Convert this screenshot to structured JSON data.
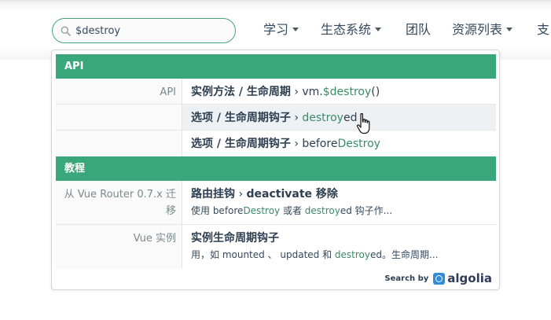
{
  "search": {
    "value": "$destroy",
    "placeholder": ""
  },
  "nav": [
    {
      "label": "学习",
      "has_caret": true
    },
    {
      "label": "生态系统",
      "has_caret": true
    },
    {
      "label": "团队",
      "has_caret": false
    },
    {
      "label": "资源列表",
      "has_caret": true
    },
    {
      "label": "支",
      "has_caret": false
    }
  ],
  "results": {
    "categories": [
      {
        "name": "API",
        "rows": [
          {
            "sub": "API",
            "title": "实例方法 / 生命周期",
            "sep": " › ",
            "pre": "vm.",
            "hl": "$destroy",
            "post": "()"
          },
          {
            "sub": "",
            "title": "选项 / 生命周期钩子",
            "sep": " › ",
            "pre": "",
            "hl": "destroy",
            "post": "ed"
          },
          {
            "sub": "",
            "title": "选项 / 生命周期钩子",
            "sep": " › ",
            "pre": "before",
            "hl": "Destroy",
            "post": ""
          }
        ]
      },
      {
        "name": "教程",
        "rows": [
          {
            "sub": "从 Vue Router 0.7.x 迁移",
            "title": "路由挂钩",
            "sep": " › ",
            "title2": "deactivate 移除",
            "snippet": {
              "a": "使用 before",
              "b": "Destroy",
              "c": " 或者 ",
              "d": "destroy",
              "e": "ed 钩子作..."
            }
          },
          {
            "sub": "Vue 实例",
            "title": "实例生命周期钩子",
            "snippet": {
              "a": "用，如 mounted 、 updated 和 ",
              "b": "destroy",
              "c": "ed。生命周期..."
            }
          }
        ]
      }
    ]
  },
  "footer": {
    "search_by": "Search by",
    "brand": "algolia"
  },
  "colors": {
    "accent": "#3aa67b",
    "highlight": "#3a8a68",
    "algolia_blue": "#2f8cd8"
  },
  "icons": [
    "search-icon",
    "caret-down-icon",
    "hand-cursor-icon",
    "algolia-logo-icon"
  ]
}
